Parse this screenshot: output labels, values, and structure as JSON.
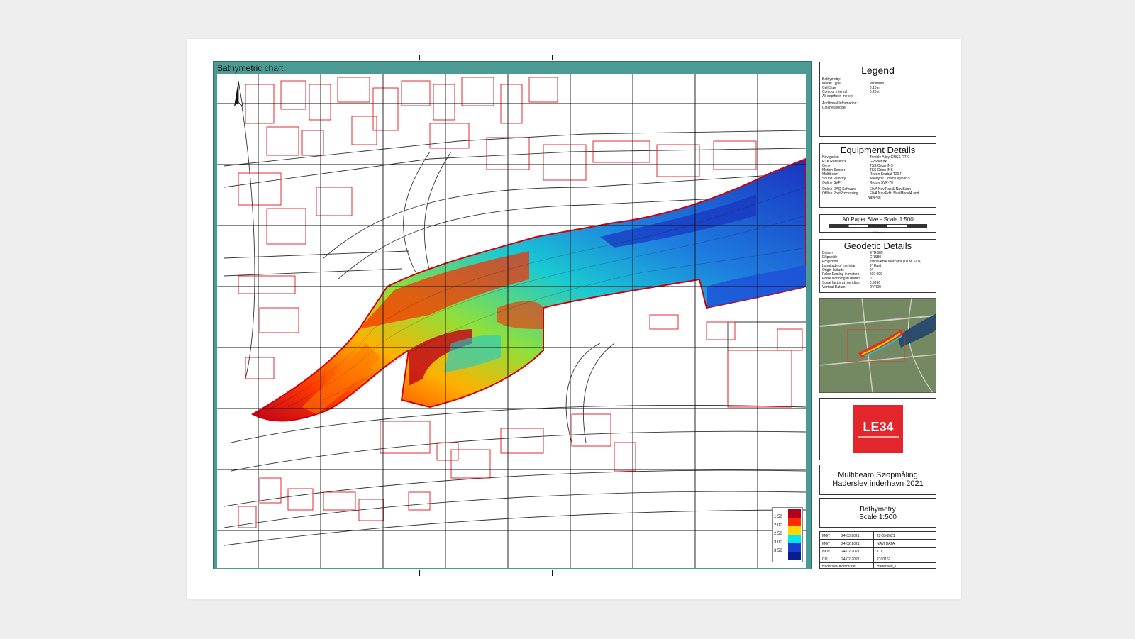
{
  "map": {
    "title": "Bathymetric chart",
    "depth_scale": {
      "labels": [
        "1.50",
        "2.00",
        "2.50",
        "3.00",
        "3.50"
      ],
      "colors": [
        "#b0001a",
        "#ff2a00",
        "#ffd800",
        "#00e7f0",
        "#1c3ccc",
        "#0b1a8e"
      ]
    },
    "palette": {
      "building": "#e0161a",
      "road": "#222222",
      "grid": "#111111",
      "frame": "#4c9a94"
    }
  },
  "legend": {
    "title": "Legend",
    "lines": [
      "Bathymetry:",
      "Model Type",
      "Cell Size",
      "Contour interval",
      "All depths in meters"
    ],
    "values": [
      "",
      ": Minimum",
      ": 0.10 m",
      ": 0.20 m",
      ""
    ],
    "additional_label": "Additional Information:",
    "additional_value": "Cleaned Model"
  },
  "equipment": {
    "title": "Equipment Details",
    "rows": [
      {
        "k": "Navigation",
        "v": ": Trimble Alloy GNSS RTK"
      },
      {
        "k": "RTK Reference",
        "v": ": GPSnet.dk"
      },
      {
        "k": "Gyro",
        "v": ": TSS Orion INS"
      },
      {
        "k": "Motion Sensor",
        "v": ": TSS Orion INS"
      },
      {
        "k": "Multibeam",
        "v": ": Reson Seabat T20-P"
      },
      {
        "k": "Sound Velocity",
        "v": ": Teledyne Odom Digibar S"
      },
      {
        "k": "Online SVP",
        "v": ": Reson SVP-70"
      },
      {
        "k": "Online DAQ Software",
        "v": ": EIVA NaviPac & NaviScan"
      },
      {
        "k": "Offline PostProcessing",
        "v": ": EIVA NaviEdit, NaviModel4 and NaviPlot"
      }
    ]
  },
  "scale_bar": {
    "label": "A0 Paper Size - Scale 1:500",
    "unit": "Meters"
  },
  "geodetic": {
    "title": "Geodetic Details",
    "rows": [
      {
        "k": "Datum",
        "v": ": ETRS89"
      },
      {
        "k": "Ellipsoide",
        "v": ": GRS80"
      },
      {
        "k": "Projection",
        "v": ": Transverse Mercator (UTM 32 N)"
      },
      {
        "k": "Longitude of meridian",
        "v": ": 9° East"
      },
      {
        "k": "Origin latitude",
        "v": ": 0°"
      },
      {
        "k": "False Easting in meters",
        "v": ": 500 000"
      },
      {
        "k": "False Northing in meters",
        "v": ": 0"
      },
      {
        "k": "Scale factor at meridian",
        "v": ": 0.9996"
      },
      {
        "k": "Vertical Datum",
        "v": ": DVR90"
      }
    ]
  },
  "logo": {
    "text": "LE34"
  },
  "project": {
    "line1": "Multibeam Søopmåling",
    "line2": "Haderslev inderhavn 2021"
  },
  "drawing": {
    "line1": "Bathymetry",
    "line2": "Scale 1:500"
  },
  "title_block": {
    "rows": [
      [
        "MGT",
        "24-03-2021",
        "22-03-2021"
      ],
      [
        "MGT",
        "24-02-2021",
        "NAVI DATA"
      ],
      [
        "NKN",
        "24-02-2021",
        "1.0"
      ],
      [
        "CO",
        "24-02-2021",
        "2100162"
      ],
      [
        "Haderslev Kommune",
        "",
        "Haderslev_1"
      ]
    ]
  }
}
